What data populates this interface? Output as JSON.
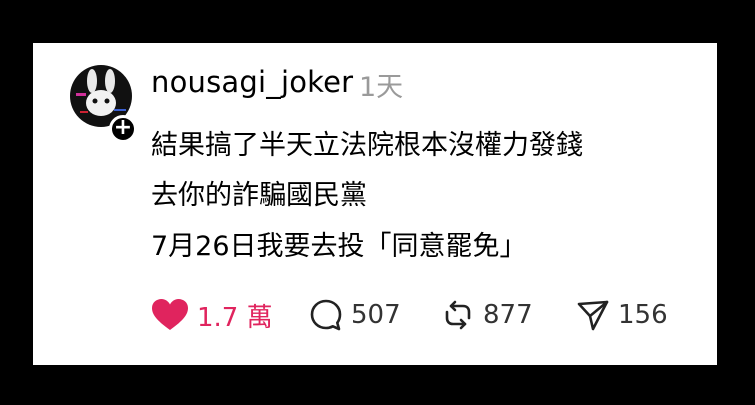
{
  "post": {
    "username": "nousagi_joker",
    "time": "1天",
    "lines": [
      "結果搞了半天立法院根本沒權力發錢",
      "去你的詐騙國民黨",
      "7月26日我要去投「同意罷免」"
    ]
  },
  "actions": {
    "likes": "1.7 萬",
    "comments": "507",
    "reposts": "877",
    "shares": "156"
  },
  "colors": {
    "like": "#e0245e",
    "background": "#000000",
    "card": "#ffffff"
  }
}
